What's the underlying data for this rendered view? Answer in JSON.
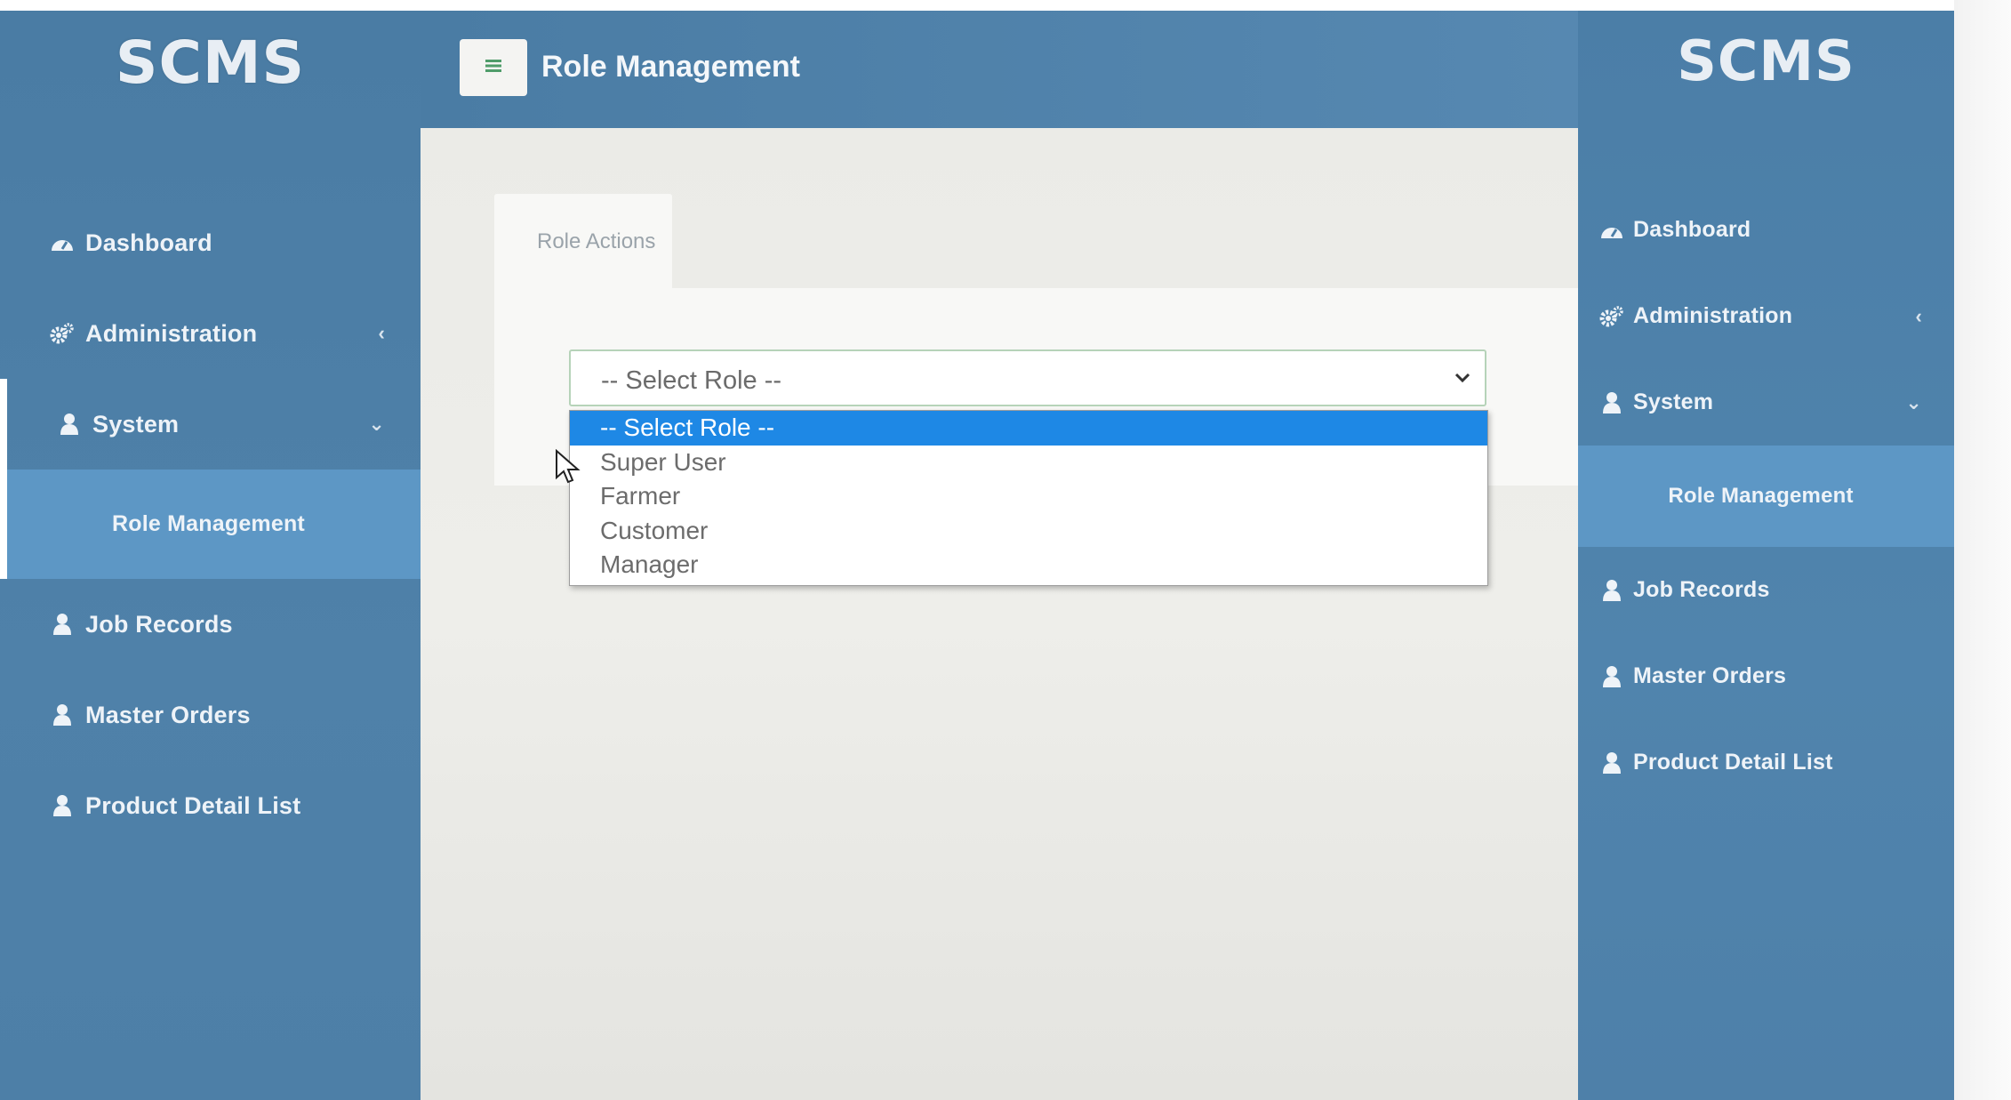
{
  "app": {
    "logo": "SCMS"
  },
  "header": {
    "menu_icon": "hamburger-icon",
    "title": "Role Management"
  },
  "sidebar": {
    "items": [
      {
        "label": "Dashboard",
        "icon": "dashboard-icon"
      },
      {
        "label": "Administration",
        "icon": "cogs-icon",
        "caret": "‹"
      },
      {
        "label": "System",
        "icon": "user-icon",
        "caret": "⌄"
      },
      {
        "label": "Role Management"
      },
      {
        "label": "Job Records",
        "icon": "user-icon"
      },
      {
        "label": "Master Orders",
        "icon": "user-icon"
      },
      {
        "label": "Product Detail List",
        "icon": "user-icon"
      }
    ]
  },
  "tabs": {
    "active": "Role Actions"
  },
  "role_select": {
    "value": "-- Select Role --",
    "options": [
      "-- Select Role --",
      "Super User",
      "Farmer",
      "Customer",
      "Manager"
    ],
    "highlighted_index": 0
  },
  "colors": {
    "sidebar_bg": "#4a7ca4",
    "submenu_bg": "#5d97c5",
    "content_bg": "#ebebe7",
    "highlight": "#1e88e5",
    "select_border": "#b6d3b9"
  }
}
